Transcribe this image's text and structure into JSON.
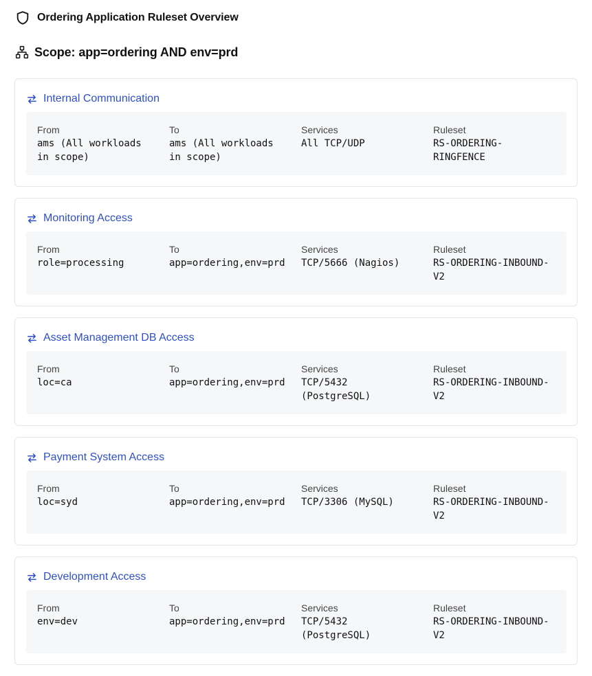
{
  "header": {
    "title": "Ordering Application Ruleset Overview",
    "icon": "shield-icon"
  },
  "scope": {
    "label": "Scope: app=ordering AND env=prd",
    "icon": "hierarchy-icon"
  },
  "labels": {
    "from": "From",
    "to": "To",
    "services": "Services",
    "ruleset": "Ruleset"
  },
  "colors": {
    "accent": "#2f4fc9",
    "panel": "#f6f7f9",
    "border": "#e4e6ea"
  },
  "rules": [
    {
      "name": "Internal Communication",
      "from": "ams (All workloads\nin scope)",
      "to": "ams (All workloads\nin scope)",
      "services": "All TCP/UDP",
      "ruleset": "RS-ORDERING-\nRINGFENCE"
    },
    {
      "name": "Monitoring Access",
      "from": "role=processing",
      "to": "app=ordering,env=prd",
      "services": "TCP/5666 (Nagios)",
      "ruleset": "RS-ORDERING-INBOUND-\nV2"
    },
    {
      "name": "Asset Management DB Access",
      "from": "loc=ca",
      "to": "app=ordering,env=prd",
      "services": "TCP/5432\n(PostgreSQL)",
      "ruleset": "RS-ORDERING-INBOUND-\nV2"
    },
    {
      "name": "Payment System Access",
      "from": "loc=syd",
      "to": "app=ordering,env=prd",
      "services": "TCP/3306 (MySQL)",
      "ruleset": "RS-ORDERING-INBOUND-\nV2"
    },
    {
      "name": "Development Access",
      "from": "env=dev",
      "to": "app=ordering,env=prd",
      "services": "TCP/5432\n(PostgreSQL)",
      "ruleset": "RS-ORDERING-INBOUND-\nV2"
    }
  ]
}
